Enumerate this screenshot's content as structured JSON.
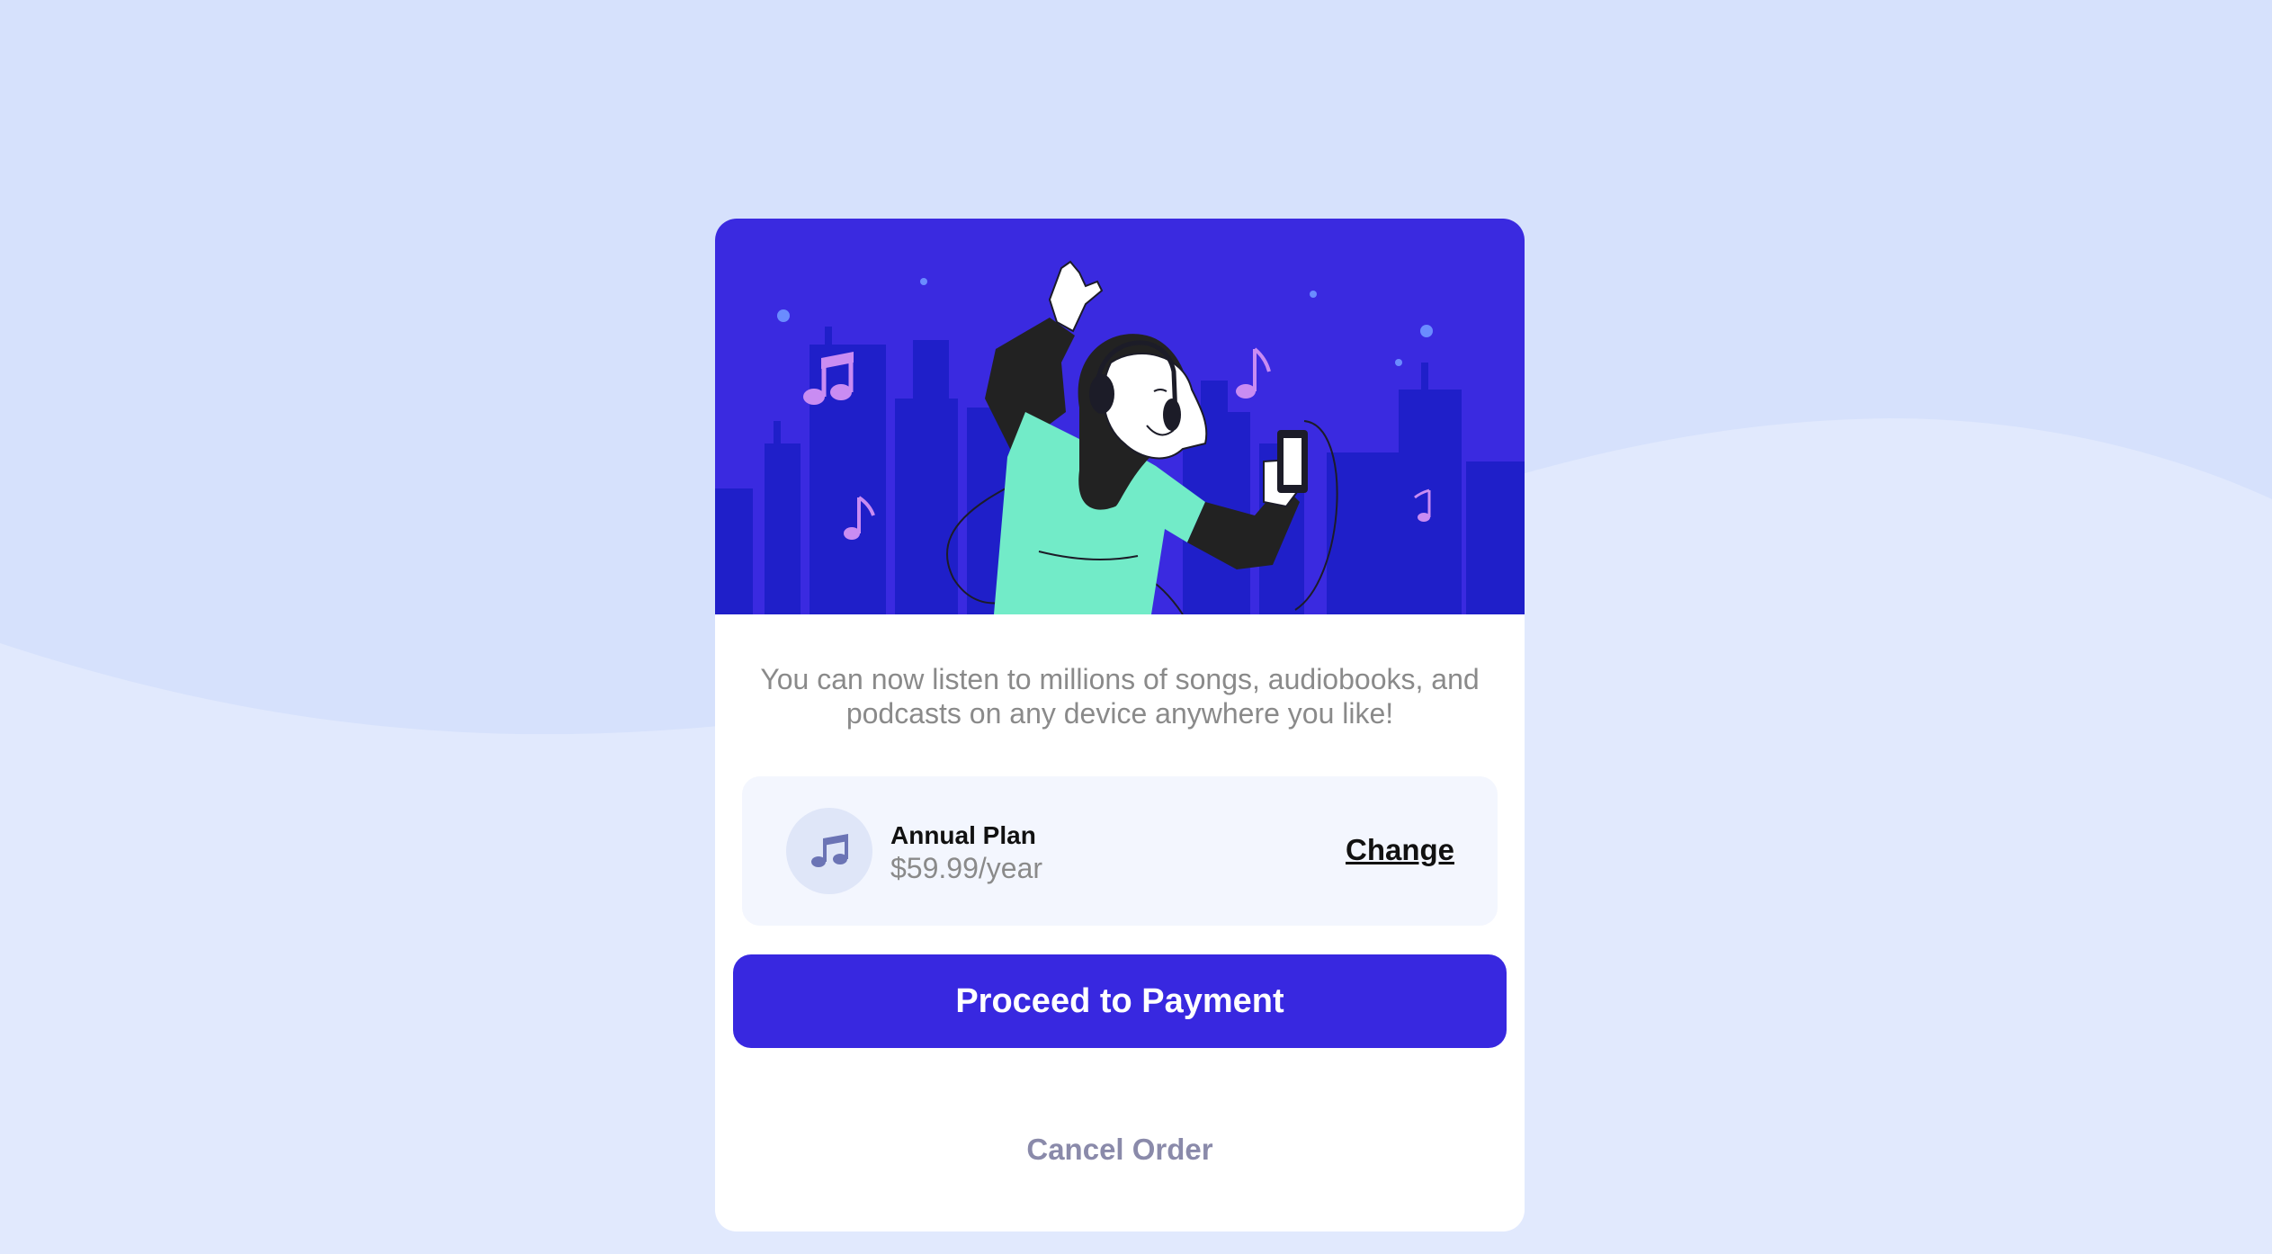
{
  "colors": {
    "page_background": "#d6e1fc",
    "card_background": "#ffffff",
    "hero_background": "#3a2ae0",
    "accent": "#3828e0",
    "plan_background": "#f3f6fe"
  },
  "hero": {
    "illustration": "person-dancing-with-headphones-illustration"
  },
  "description": "You can now listen to millions of songs, audiobooks, and podcasts on any device anywhere you like!",
  "plan": {
    "icon": "music-note-icon",
    "name": "Annual Plan",
    "price": "$59.99/year",
    "change_label": "Change"
  },
  "actions": {
    "proceed_label": "Proceed to Payment",
    "cancel_label": "Cancel Order"
  }
}
